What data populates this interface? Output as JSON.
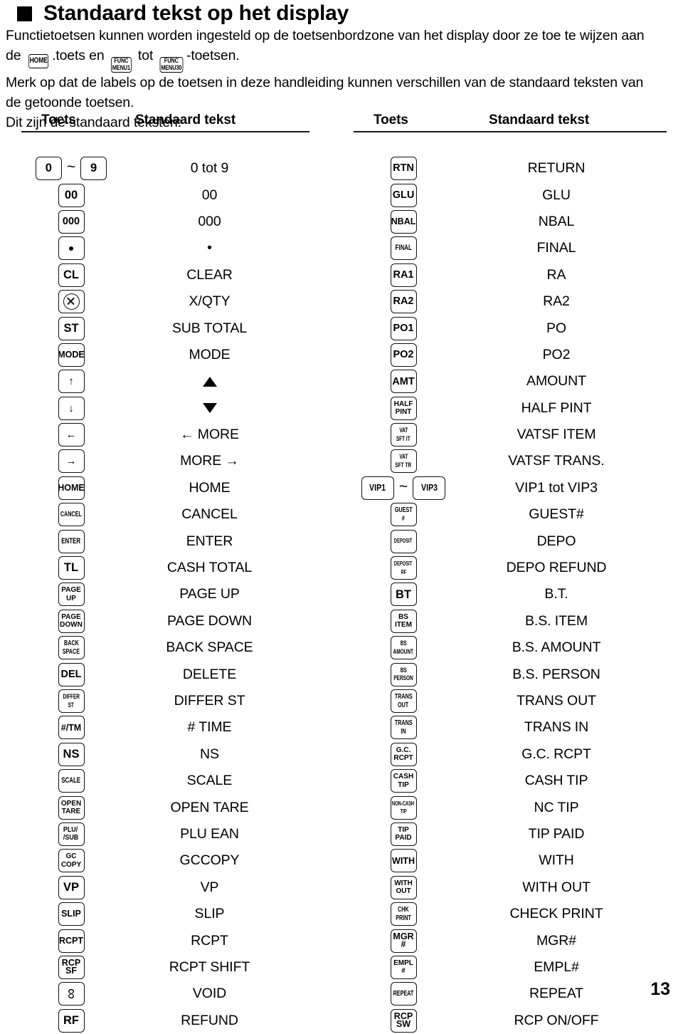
{
  "heading": {
    "bullet": "black-square",
    "title": "Standaard tekst op het display"
  },
  "intro": {
    "line1": "Functietoetsen kunnen worden ingesteld op de toetsenbordzone van het display door ze toe te wijzen aan",
    "line2_a": "de",
    "key_home": "HOME",
    "line2_b": ".toets en",
    "key_funcmenu1_l1": "FUNC",
    "key_funcmenu1_l2": "MENU1",
    "line2_c": "tot",
    "key_funcmenu30_l1": "FUNC",
    "key_funcmenu30_l2": "MENU30",
    "line2_d": "-toetsen.",
    "line3": "Merk op dat de labels op de toetsen in deze handleiding kunnen verschillen van de standaard teksten van",
    "line4": "de getoonde toetsen.",
    "line5": "Dit zijn de standaard teksten:"
  },
  "table": {
    "headers": {
      "key": "Toets",
      "text": "Standaard tekst"
    },
    "left_rows": [
      {
        "key": {
          "type": "pair",
          "left": "0",
          "right": "9",
          "sep": "~"
        },
        "text": "0 tot 9"
      },
      {
        "key": {
          "type": "single",
          "lines": [
            "00"
          ]
        },
        "text": "00"
      },
      {
        "key": {
          "type": "single",
          "lines": [
            "000"
          ]
        },
        "text": "000"
      },
      {
        "key": {
          "type": "glyph",
          "glyph": "dot"
        },
        "text": "•"
      },
      {
        "key": {
          "type": "single",
          "lines": [
            "CL"
          ]
        },
        "text": "CLEAR"
      },
      {
        "key": {
          "type": "glyph",
          "glyph": "circled-x"
        },
        "text": "X/QTY"
      },
      {
        "key": {
          "type": "single",
          "lines": [
            "ST"
          ]
        },
        "text": "SUB TOTAL"
      },
      {
        "key": {
          "type": "single",
          "lines": [
            "MODE"
          ]
        },
        "text": "MODE"
      },
      {
        "key": {
          "type": "glyph",
          "glyph": "arrow-up"
        },
        "text": "triangle-up"
      },
      {
        "key": {
          "type": "glyph",
          "glyph": "arrow-down"
        },
        "text": "triangle-down"
      },
      {
        "key": {
          "type": "glyph",
          "glyph": "arrow-left"
        },
        "text": "← MORE"
      },
      {
        "key": {
          "type": "glyph",
          "glyph": "arrow-right"
        },
        "text": "MORE →"
      },
      {
        "key": {
          "type": "single",
          "lines": [
            "HOME"
          ]
        },
        "text": "HOME"
      },
      {
        "key": {
          "type": "single",
          "lines": [
            "CANCEL"
          ]
        },
        "text": "CANCEL"
      },
      {
        "key": {
          "type": "single",
          "lines": [
            "ENTER"
          ]
        },
        "text": "ENTER"
      },
      {
        "key": {
          "type": "single",
          "lines": [
            "TL"
          ]
        },
        "text": "CASH TOTAL"
      },
      {
        "key": {
          "type": "double",
          "lines": [
            "PAGE",
            "UP"
          ]
        },
        "text": "PAGE UP"
      },
      {
        "key": {
          "type": "double",
          "lines": [
            "PAGE",
            "DOWN"
          ]
        },
        "text": "PAGE DOWN"
      },
      {
        "key": {
          "type": "double",
          "lines": [
            "BACK",
            "SPACE"
          ]
        },
        "text": "BACK SPACE"
      },
      {
        "key": {
          "type": "single",
          "lines": [
            "DEL"
          ]
        },
        "text": "DELETE"
      },
      {
        "key": {
          "type": "double",
          "lines": [
            "DIFFER",
            "ST"
          ]
        },
        "text": "DIFFER ST"
      },
      {
        "key": {
          "type": "single",
          "lines": [
            "#/TM"
          ]
        },
        "text": "# TIME"
      },
      {
        "key": {
          "type": "single",
          "lines": [
            "NS"
          ]
        },
        "text": "NS"
      },
      {
        "key": {
          "type": "single",
          "lines": [
            "SCALE"
          ]
        },
        "text": "SCALE"
      },
      {
        "key": {
          "type": "double",
          "lines": [
            "OPEN",
            "TARE"
          ]
        },
        "text": "OPEN TARE"
      },
      {
        "key": {
          "type": "plusub",
          "lines": [
            "PLU/",
            "/SUB"
          ]
        },
        "text": "PLU EAN"
      },
      {
        "key": {
          "type": "double",
          "lines": [
            "GC",
            "COPY"
          ]
        },
        "text": "GCCOPY"
      },
      {
        "key": {
          "type": "single",
          "lines": [
            "VP"
          ]
        },
        "text": "VP"
      },
      {
        "key": {
          "type": "single",
          "lines": [
            "SLIP"
          ]
        },
        "text": "SLIP"
      },
      {
        "key": {
          "type": "single",
          "lines": [
            "RCPT"
          ]
        },
        "text": "RCPT"
      },
      {
        "key": {
          "type": "double",
          "lines": [
            "RCP",
            "SF"
          ]
        },
        "text": "RCPT SHIFT"
      },
      {
        "key": {
          "type": "glyph",
          "glyph": "void-loop"
        },
        "text": "VOID"
      },
      {
        "key": {
          "type": "single",
          "lines": [
            "RF"
          ]
        },
        "text": "REFUND"
      }
    ],
    "right_rows": [
      {
        "key": {
          "type": "single",
          "lines": [
            "RTN"
          ]
        },
        "text": "RETURN"
      },
      {
        "key": {
          "type": "single",
          "lines": [
            "GLU"
          ]
        },
        "text": "GLU"
      },
      {
        "key": {
          "type": "single",
          "lines": [
            "NBAL"
          ]
        },
        "text": "NBAL"
      },
      {
        "key": {
          "type": "single",
          "lines": [
            "FINAL"
          ]
        },
        "text": "FINAL"
      },
      {
        "key": {
          "type": "single",
          "lines": [
            "RA1"
          ]
        },
        "text": "RA"
      },
      {
        "key": {
          "type": "single",
          "lines": [
            "RA2"
          ]
        },
        "text": "RA2"
      },
      {
        "key": {
          "type": "single",
          "lines": [
            "PO1"
          ]
        },
        "text": "PO"
      },
      {
        "key": {
          "type": "single",
          "lines": [
            "PO2"
          ]
        },
        "text": "PO2"
      },
      {
        "key": {
          "type": "single",
          "lines": [
            "AMT"
          ]
        },
        "text": "AMOUNT"
      },
      {
        "key": {
          "type": "double",
          "lines": [
            "HALF",
            "PINT"
          ]
        },
        "text": "HALF PINT"
      },
      {
        "key": {
          "type": "double",
          "lines": [
            "VAT",
            "SFT IT"
          ]
        },
        "text": "VATSF ITEM"
      },
      {
        "key": {
          "type": "double",
          "lines": [
            "VAT",
            "SFT TR"
          ]
        },
        "text": "VATSF TRANS."
      },
      {
        "key": {
          "type": "pair",
          "left": "VIP1",
          "right": "VIP3",
          "sep": "~"
        },
        "text": "VIP1 tot VIP3"
      },
      {
        "key": {
          "type": "double",
          "lines": [
            "GUEST",
            "#"
          ]
        },
        "text": "GUEST#"
      },
      {
        "key": {
          "type": "single",
          "lines": [
            "DEPOSIT"
          ]
        },
        "text": "DEPO"
      },
      {
        "key": {
          "type": "double",
          "lines": [
            "DEPOSIT",
            "RF"
          ]
        },
        "text": "DEPO REFUND"
      },
      {
        "key": {
          "type": "single",
          "lines": [
            "BT"
          ]
        },
        "text": "B.T."
      },
      {
        "key": {
          "type": "double",
          "lines": [
            "BS",
            "ITEM"
          ]
        },
        "text": "B.S. ITEM"
      },
      {
        "key": {
          "type": "double",
          "lines": [
            "BS",
            "AMOUNT"
          ]
        },
        "text": "B.S. AMOUNT"
      },
      {
        "key": {
          "type": "double",
          "lines": [
            "BS",
            "PERSON"
          ]
        },
        "text": "B.S. PERSON"
      },
      {
        "key": {
          "type": "double",
          "lines": [
            "TRANS",
            "OUT"
          ]
        },
        "text": "TRANS OUT"
      },
      {
        "key": {
          "type": "double",
          "lines": [
            "TRANS",
            "IN"
          ]
        },
        "text": "TRANS IN"
      },
      {
        "key": {
          "type": "double",
          "lines": [
            "G.C.",
            "RCPT"
          ]
        },
        "text": "G.C. RCPT"
      },
      {
        "key": {
          "type": "double",
          "lines": [
            "CASH",
            "TIP"
          ]
        },
        "text": "CASH TIP"
      },
      {
        "key": {
          "type": "double",
          "lines": [
            "NON-CASH",
            "TIP"
          ]
        },
        "text": "NC TIP"
      },
      {
        "key": {
          "type": "double",
          "lines": [
            "TIP",
            "PAID"
          ]
        },
        "text": "TIP PAID"
      },
      {
        "key": {
          "type": "single",
          "lines": [
            "WITH"
          ]
        },
        "text": "WITH"
      },
      {
        "key": {
          "type": "double",
          "lines": [
            "WITH",
            "OUT"
          ]
        },
        "text": "WITH OUT"
      },
      {
        "key": {
          "type": "double",
          "lines": [
            "CHK",
            "PRINT"
          ]
        },
        "text": "CHECK PRINT"
      },
      {
        "key": {
          "type": "double",
          "lines": [
            "MGR",
            "#"
          ]
        },
        "text": "MGR#"
      },
      {
        "key": {
          "type": "double",
          "lines": [
            "EMPL",
            "#"
          ]
        },
        "text": "EMPL#"
      },
      {
        "key": {
          "type": "single",
          "lines": [
            "REPEAT"
          ]
        },
        "text": "REPEAT"
      },
      {
        "key": {
          "type": "double",
          "lines": [
            "RCP",
            "SW"
          ]
        },
        "text": "RCP ON/OFF"
      }
    ]
  },
  "footer": {
    "page_number": "13"
  }
}
